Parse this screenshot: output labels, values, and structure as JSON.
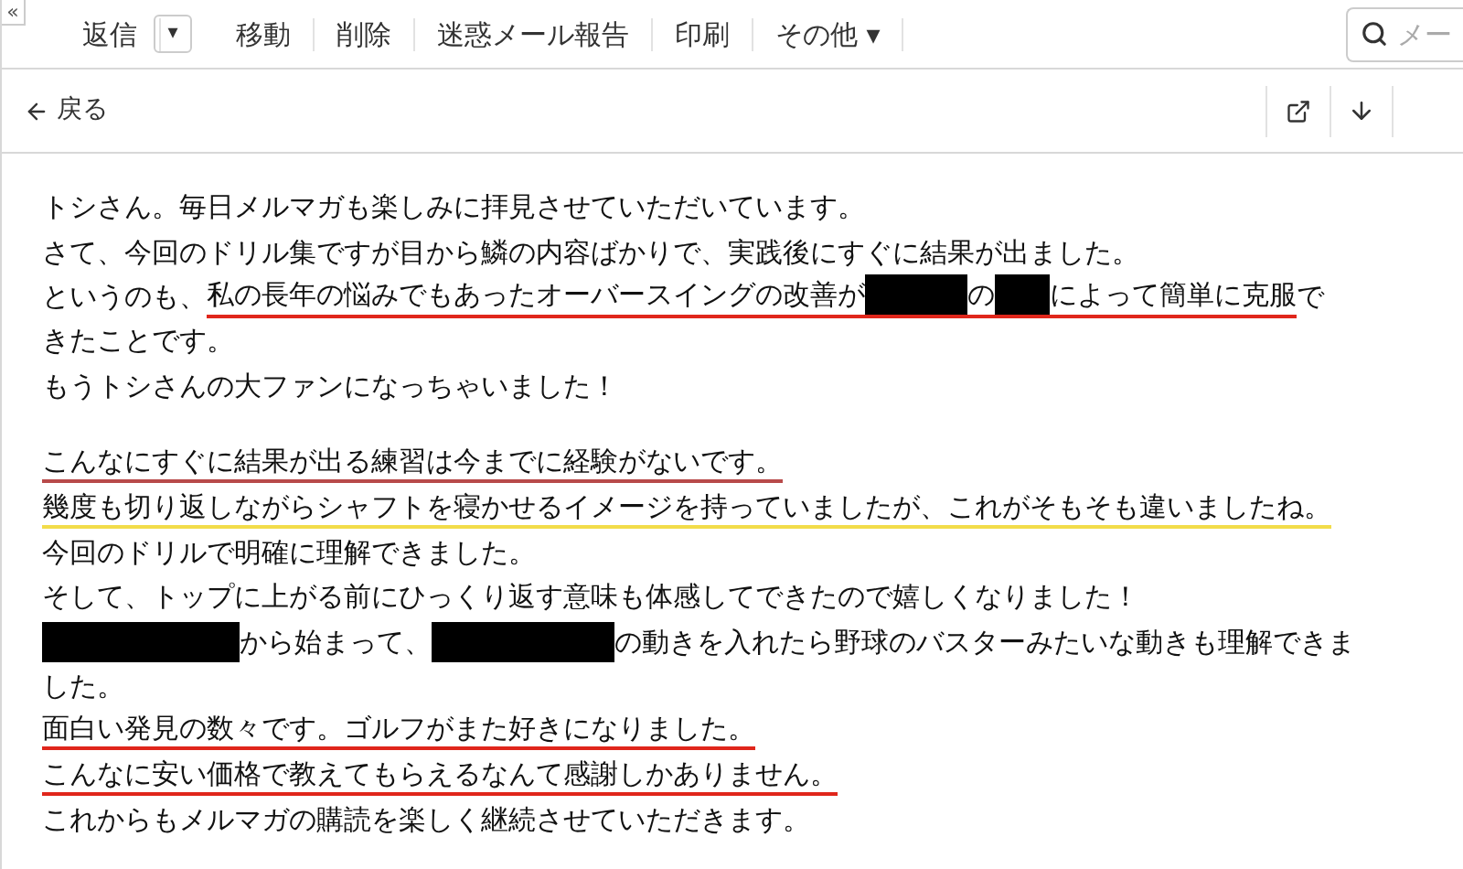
{
  "collapse_button": "«",
  "toolbar": {
    "items": [
      {
        "kind": "button",
        "label": "返信"
      },
      {
        "kind": "menu",
        "label": "▾"
      },
      {
        "kind": "button",
        "label": "移動"
      },
      {
        "kind": "button",
        "label": "削除"
      },
      {
        "kind": "button",
        "label": "迷惑メール報告"
      },
      {
        "kind": "button",
        "label": "印刷"
      },
      {
        "kind": "dropdown",
        "label": "その他",
        "caret": "▾"
      }
    ],
    "search": {
      "placeholder": "メー"
    }
  },
  "nav": {
    "back": "戻る"
  },
  "body": {
    "paragraphs": [
      [
        [
          {
            "kind": "text",
            "text": "トシさん。毎日メルマガも楽しみに拝見させていただいています。"
          }
        ],
        [
          {
            "kind": "text",
            "text": "さて、今回のドリル集ですが目から鱗の内容ばかりで、実践後にすぐに結果が出ました。"
          }
        ],
        [
          {
            "kind": "text",
            "text": "というのも、"
          },
          {
            "kind": "underlined",
            "color": "#e0261b",
            "parts": [
              {
                "kind": "text",
                "text": "私の長年の悩みでもあったオーバースイングの改善が"
              },
              {
                "kind": "redacted"
              },
              {
                "kind": "text",
                "text": "の"
              },
              {
                "kind": "redacted"
              },
              {
                "kind": "text",
                "text": "によって簡単に克服"
              }
            ]
          },
          {
            "kind": "text",
            "text": "で"
          }
        ],
        [
          {
            "kind": "text",
            "text": "きたことです。"
          }
        ],
        [
          {
            "kind": "text",
            "text": "もうトシさんの大ファンになっちゃいました！"
          }
        ]
      ],
      [
        [
          {
            "kind": "text",
            "text": "こんなにすぐに結果が出る練習は今までに経験がないです。",
            "color": "#b84a4a"
          }
        ],
        [
          {
            "kind": "text",
            "text": "幾度も切り返しながらシャフトを寝かせるイメージを持っていましたが、これがそもそも違いましたね。",
            "color": "#f2dc4a"
          }
        ],
        [
          {
            "kind": "text",
            "text": "今回のドリルで明確に理解できました。"
          }
        ],
        [
          {
            "kind": "text",
            "text": "そして、トップに上がる前にひっくり返す意味も体感してできたので嬉しくなりました！"
          }
        ],
        [
          {
            "kind": "redacted"
          },
          {
            "kind": "text",
            "text": "から始まって、"
          },
          {
            "kind": "redacted"
          },
          {
            "kind": "text",
            "text": "の動きを入れたら野球のバスターみたいな動きも理解できま"
          }
        ],
        [
          {
            "kind": "text",
            "text": "した。"
          }
        ],
        [
          {
            "kind": "text",
            "text": "面白い発見の数々です。ゴルフがまた好きになりました。",
            "color": "#e0261b"
          }
        ],
        [
          {
            "kind": "text",
            "text": "こんなに安い価格で教えてもらえるなんて感謝しかありません。",
            "color": "#e0261b"
          }
        ],
        [
          {
            "kind": "text",
            "text": "これからもメルマガの購読を楽しく継続させていただきます。"
          }
        ]
      ]
    ]
  }
}
